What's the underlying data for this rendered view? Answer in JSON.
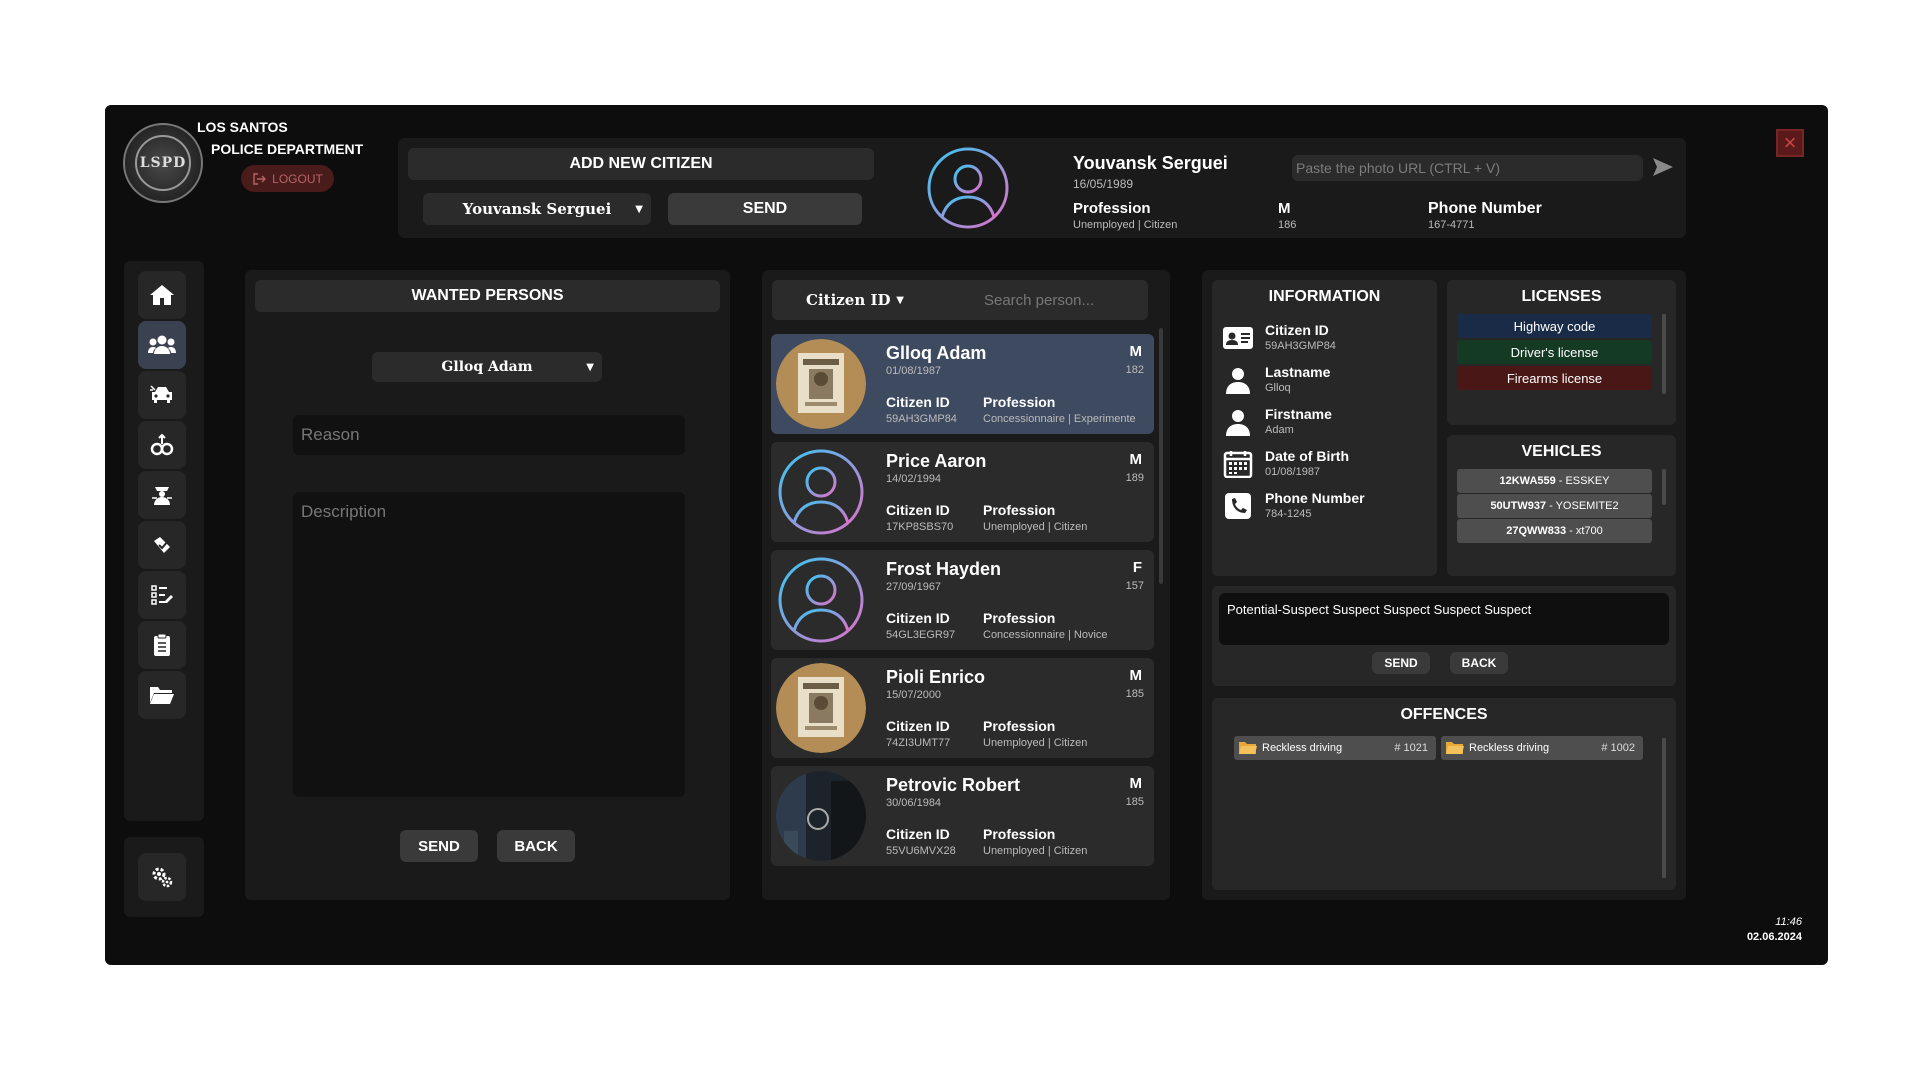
{
  "header": {
    "dept_line1": "LOS SANTOS",
    "dept_line2": "POLICE DEPARTMENT",
    "logo_text": "LSPD",
    "logout_label": "LOGOUT",
    "close_label": "×"
  },
  "add_citizen": {
    "title": "ADD NEW CITIZEN",
    "selected": "Youvansk Serguei",
    "send_label": "SEND"
  },
  "current_citizen": {
    "name": "Youvansk Serguei",
    "dob": "16/05/1989",
    "profession_label": "Profession",
    "profession_value": "Unemployed | Citizen",
    "sex": "M",
    "height": "186",
    "phone_label": "Phone Number",
    "phone_value": "167-4771",
    "photo_placeholder": "Paste the photo URL (CTRL + V)"
  },
  "sidebar": {
    "items": [
      {
        "icon": "home-icon"
      },
      {
        "icon": "citizens-icon",
        "active": true
      },
      {
        "icon": "vehicle-crash-icon"
      },
      {
        "icon": "handcuffs-icon"
      },
      {
        "icon": "officer-icon"
      },
      {
        "icon": "evidence-icon"
      },
      {
        "icon": "report-icon"
      },
      {
        "icon": "clipboard-icon"
      },
      {
        "icon": "folder-icon"
      }
    ],
    "settings_icon": "gears-icon"
  },
  "wanted": {
    "title": "WANTED PERSONS",
    "selected": "Glloq Adam",
    "reason_placeholder": "Reason",
    "description_placeholder": "Description",
    "send_label": "SEND",
    "back_label": "BACK"
  },
  "list": {
    "filter": "Citizen ID",
    "search_placeholder": "Search person...",
    "cid_label": "Citizen ID",
    "profession_label": "Profession",
    "citizens": [
      {
        "name": "Glloq Adam",
        "dob": "01/08/1987",
        "sex": "M",
        "height": "182",
        "cid": "59AH3GMP84",
        "profession": "Concessionnaire | Experimente",
        "photo": "wanted-poster",
        "active": true
      },
      {
        "name": "Price Aaron",
        "dob": "14/02/1994",
        "sex": "M",
        "height": "189",
        "cid": "17KP8SBS70",
        "profession": "Unemployed | Citizen",
        "photo": "default-avatar"
      },
      {
        "name": "Frost Hayden",
        "dob": "27/09/1967",
        "sex": "F",
        "height": "157",
        "cid": "54GL3EGR97",
        "profession": "Concessionnaire | Novice",
        "photo": "default-avatar"
      },
      {
        "name": "Pioli Enrico",
        "dob": "15/07/2000",
        "sex": "M",
        "height": "185",
        "cid": "74ZI3UMT77",
        "profession": "Unemployed | Citizen",
        "photo": "wanted-poster"
      },
      {
        "name": "Petrovic Robert",
        "dob": "30/06/1984",
        "sex": "M",
        "height": "185",
        "cid": "55VU6MVX28",
        "profession": "Unemployed | Citizen",
        "photo": "street-photo"
      }
    ]
  },
  "information": {
    "title": "INFORMATION",
    "rows": [
      {
        "icon": "id-card-icon",
        "label": "Citizen ID",
        "value": "59AH3GMP84"
      },
      {
        "icon": "user-icon",
        "label": "Lastname",
        "value": "Glloq"
      },
      {
        "icon": "user-icon",
        "label": "Firstname",
        "value": "Adam"
      },
      {
        "icon": "calendar-icon",
        "label": "Date of Birth",
        "value": "01/08/1987"
      },
      {
        "icon": "phone-icon",
        "label": "Phone Number",
        "value": "784-1245"
      }
    ]
  },
  "licenses": {
    "title": "LICENSES",
    "items": [
      {
        "label": "Highway code",
        "color": "#1a2b48"
      },
      {
        "label": "Driver's license",
        "color": "#153a24"
      },
      {
        "label": "Firearms license",
        "color": "#4a1717"
      }
    ]
  },
  "vehicles": {
    "title": "VEHICLES",
    "items": [
      {
        "plate": "12KWA559",
        "model": "- ESSKEY"
      },
      {
        "plate": "50UTW937",
        "model": "- YOSEMITE2"
      },
      {
        "plate": "27QWW833",
        "model": "- xt700"
      }
    ]
  },
  "note": {
    "text": "Potential-Suspect Suspect Suspect Suspect Suspect",
    "send_label": "SEND",
    "back_label": "BACK"
  },
  "offences": {
    "title": "OFFENCES",
    "items": [
      {
        "label": "Reckless driving",
        "number": "# 1021"
      },
      {
        "label": "Reckless driving",
        "number": "# 1002"
      }
    ]
  },
  "clock": {
    "time": "11:46",
    "date": "02.06.2024"
  }
}
